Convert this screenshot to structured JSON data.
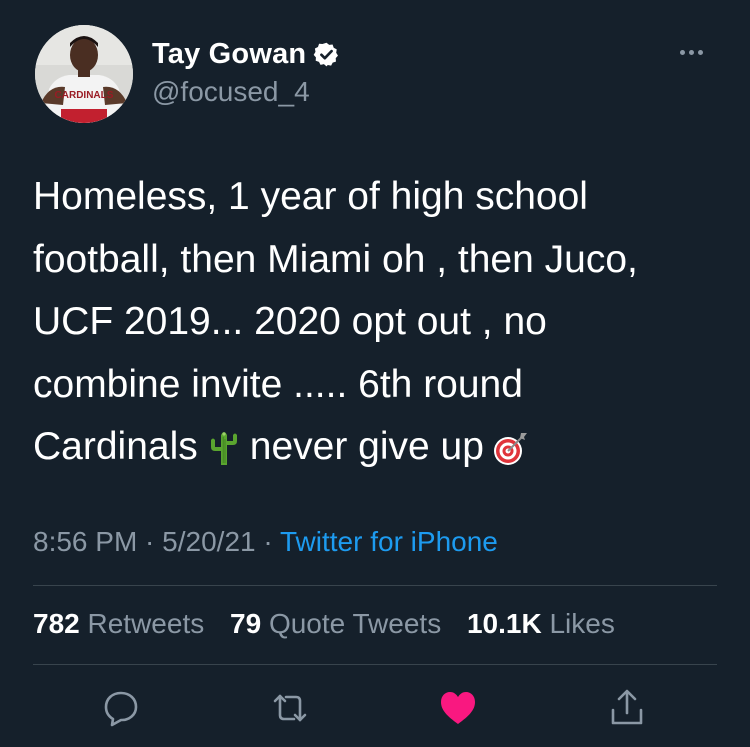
{
  "user": {
    "display_name": "Tay Gowan",
    "handle": "@focused_4",
    "avatar_shirt_text": "CARDINALS"
  },
  "tweet": {
    "lines": [
      "Homeless, 1 year of high school",
      "football, then Miami oh , then Juco,",
      "UCF 2019... 2020 opt out , no",
      "combine invite ..... 6th round"
    ],
    "line5_before": "Cardinals",
    "line5_after": "never give up",
    "emoji_1": "cactus-emoji",
    "emoji_2": "direct-hit-emoji"
  },
  "meta": {
    "time": "8:56 PM",
    "sep1": " · ",
    "date": "5/20/21",
    "sep2": " · ",
    "source": "Twitter for iPhone"
  },
  "stats": {
    "retweets_count": "782",
    "retweets_label": "Retweets",
    "quotes_count": "79",
    "quotes_label": "Quote Tweets",
    "likes_count": "10.1K",
    "likes_label": "Likes"
  },
  "colors": {
    "background": "#15202b",
    "muted": "#8b98a5",
    "link": "#1d9bf0",
    "like": "#f91880",
    "divider": "#38444d"
  },
  "icons": [
    "reply-icon",
    "retweet-icon",
    "like-icon",
    "share-icon",
    "more-icon",
    "verified-badge-icon"
  ]
}
